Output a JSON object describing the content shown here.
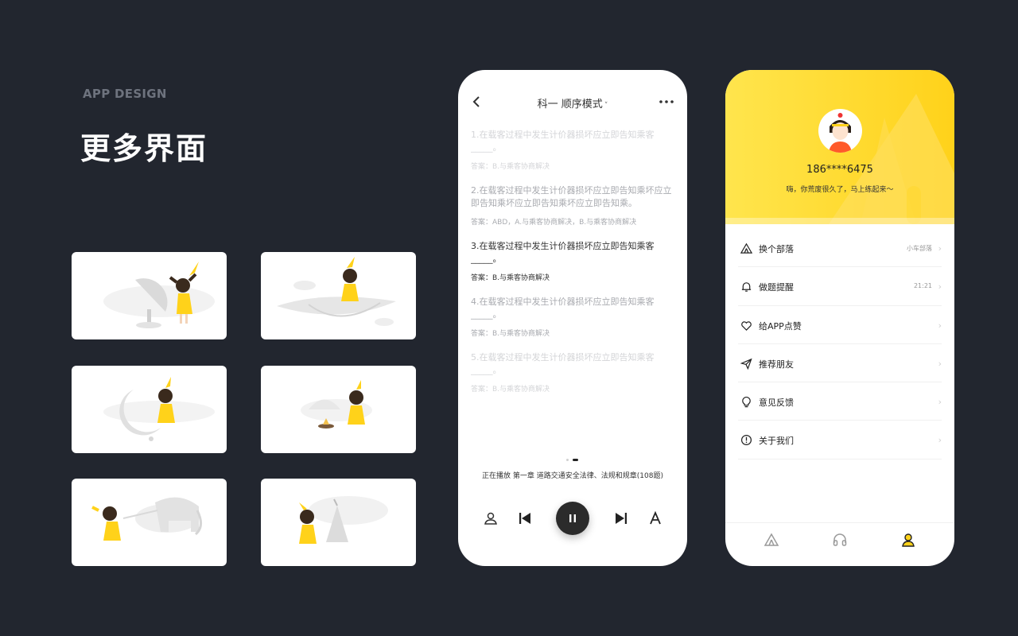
{
  "intro": {
    "kicker": "APP DESIGN",
    "headline": "更多界面"
  },
  "quiz": {
    "title": "科一 顺序模式",
    "caret": "˅",
    "questions": [
      {
        "text": "1.在载客过程中发生计价器损坏应立即告知乘客_____。",
        "answer": "答案：B.与乘客协商解决"
      },
      {
        "text": "2.在载客过程中发生计价器损坏应立即告知乘坏应立即告知乘坏应立即告知乘坏应立即告知乘。",
        "answer": "答案：ABD，A.与乘客协商解决，B.与乘客协商解决"
      },
      {
        "text": "3.在载客过程中发生计价器损坏应立即告知乘客_____。",
        "answer": "答案：B.与乘客协商解决"
      },
      {
        "text": "4.在载客过程中发生计价器损坏应立即告知乘客_____。",
        "answer": "答案：B.与乘客协商解决"
      },
      {
        "text": "5.在载客过程中发生计价器损坏应立即告知乘客_____。",
        "answer": "答案：B.与乘客协商解决"
      }
    ],
    "now_playing": "正在播放 第一章 道路交通安全法律、法规和规章(108题)",
    "icons": [
      "back-arrow",
      "more-dots",
      "person",
      "previous",
      "pause",
      "next",
      "font-a"
    ]
  },
  "profile": {
    "phone": "186****6475",
    "greeting": "嗨，你荒废很久了，马上练起来～",
    "menu": [
      {
        "label": "换个部落",
        "value": "小车部落",
        "icon": "tent"
      },
      {
        "label": "做题提醒",
        "value": "21:21",
        "icon": "bell"
      },
      {
        "label": "给APP点赞",
        "value": "",
        "icon": "heart"
      },
      {
        "label": "推荐朋友",
        "value": "",
        "icon": "send"
      },
      {
        "label": "意见反馈",
        "value": "",
        "icon": "bulb"
      },
      {
        "label": "关于我们",
        "value": "",
        "icon": "info"
      }
    ],
    "chevron": "›",
    "tabs": [
      "tent",
      "headphones",
      "person"
    ]
  },
  "colors": {
    "background": "#22262f",
    "accent": "#ffd21a",
    "accent_light": "#ffe54d",
    "dark_button": "#2b2b2b"
  }
}
